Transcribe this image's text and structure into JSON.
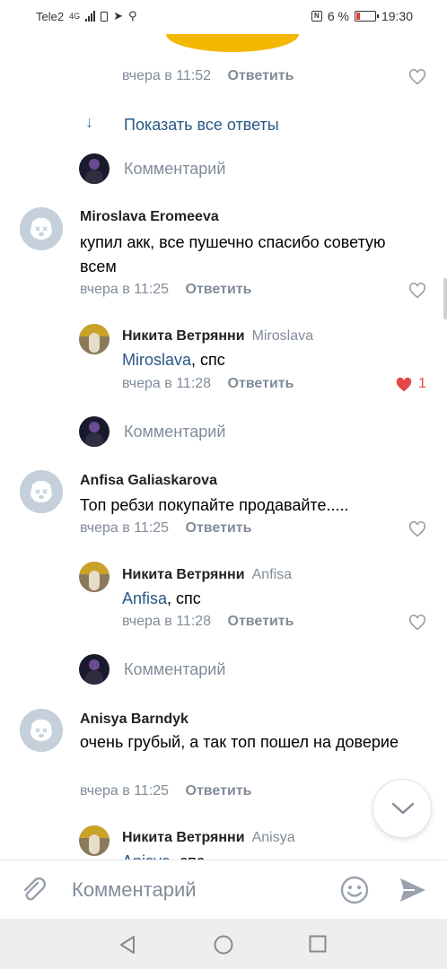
{
  "status_bar": {
    "carrier": "Tele2",
    "network": "4G",
    "battery_percent": "6 %",
    "time": "19:30"
  },
  "top_comment": {
    "time": "вчера в 11:52",
    "reply_label": "Ответить"
  },
  "show_all_replies": "Показать все ответы",
  "comment_prompt": "Комментарий",
  "comments": [
    {
      "author": "Miroslava Eromeeva",
      "text": "купил акк, все пушечно спасибо советую   всем",
      "time": "вчера в 11:25",
      "reply_label": "Ответить",
      "reply": {
        "author": "Никита Ветрянни",
        "to": "Miroslava",
        "mention": "Miroslava",
        "text": ", спс",
        "time": "вчера в 11:28",
        "reply_label": "Ответить",
        "likes": "1"
      },
      "prompt": "Комментарий"
    },
    {
      "author": "Anfisa Galiaskarova",
      "text": "Топ ребзи покупайте продавайте.....",
      "time": "вчера в 11:25",
      "reply_label": "Ответить",
      "reply": {
        "author": "Никита Ветрянни",
        "to": "Anfisa",
        "mention": "Anfisa",
        "text": ", спс",
        "time": "вчера в 11:28",
        "reply_label": "Ответить"
      },
      "prompt": "Комментарий"
    },
    {
      "author": "Anisya Barndyk",
      "text": "очень грубый, а так топ пошел на доверие",
      "time": "вчера в 11:25",
      "reply_label": "Ответить",
      "reply": {
        "author": "Никита Ветрянни",
        "to": "Anisya",
        "mention": "Anisya",
        "text": ", спс"
      }
    }
  ],
  "composer": {
    "placeholder": "Комментарий"
  },
  "colors": {
    "link": "#2a5885",
    "meta": "#818c99",
    "like": "#e64646",
    "accent_blue": "#2a7bd5"
  }
}
